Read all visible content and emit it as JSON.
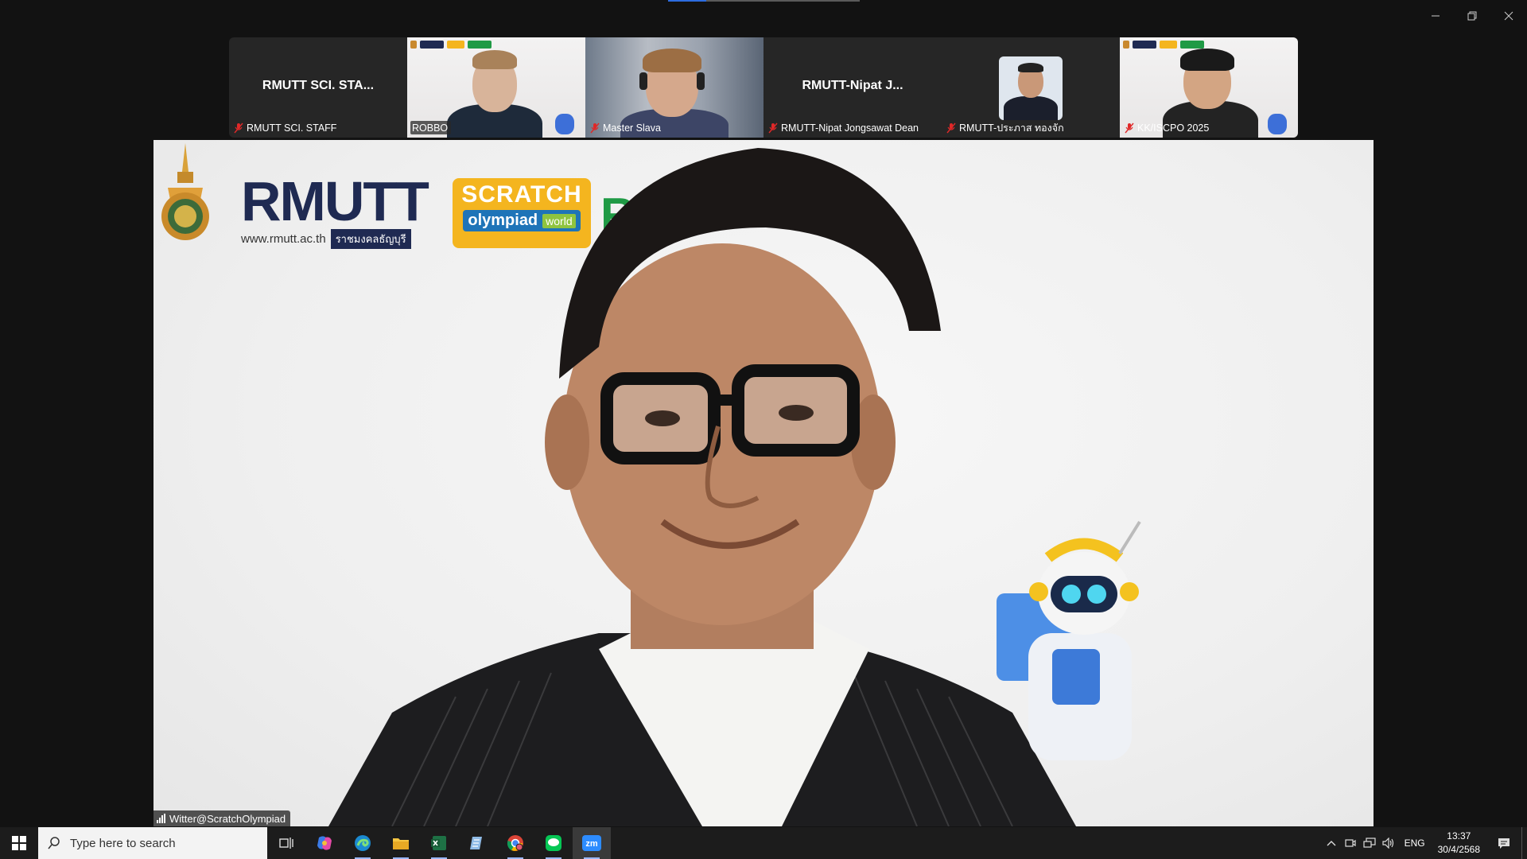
{
  "window": {
    "minimize_icon": "minimize-icon",
    "restore_icon": "restore-icon",
    "close_icon": "close-icon"
  },
  "participants": [
    {
      "tile_name": "RMUTT SCI. STA...",
      "label": "RMUTT SCI. STAFF",
      "muted": true,
      "video": false
    },
    {
      "tile_name": "",
      "label": "ROBBO",
      "muted": false,
      "video": true
    },
    {
      "tile_name": "",
      "label": "Master Slava",
      "muted": true,
      "video": true
    },
    {
      "tile_name": "RMUTT-Nipat J...",
      "label": "RMUTT-Nipat Jongsawat Dean",
      "muted": true,
      "video": false
    },
    {
      "tile_name": "",
      "label": "RMUTT-ประภาส ทองจัก",
      "muted": true,
      "video": false
    },
    {
      "tile_name": "",
      "label": "KK/ISCPO 2025",
      "muted": true,
      "video": true
    }
  ],
  "main": {
    "speaker_label": "Witter@ScratchOlympiad",
    "logos": {
      "rmutt": "RMUTT",
      "rmutt_url": "www.rmutt.ac.th",
      "rmutt_thai": "ราชมงคลธัญบุรี",
      "scratch_title": "SCRATCH",
      "scratch_olympiad": "olympiad",
      "scratch_world": "world",
      "robbo_partial": "RO"
    }
  },
  "taskbar": {
    "search_placeholder": "Type here to search",
    "apps": [
      "task-view-icon",
      "copilot-icon",
      "edge-icon",
      "file-explorer-icon",
      "excel-icon",
      "notepad-icon",
      "chrome-icon",
      "line-icon",
      "zoom-icon"
    ],
    "zoom_label": "zm",
    "language": "ENG",
    "time": "13:37",
    "date": "30/4/2568"
  },
  "colors": {
    "zoom_active": "#2d8cff",
    "rmutt_navy": "#1f2a52",
    "scratch_yellow": "#f4b51f",
    "robbo_green": "#1f9a45"
  }
}
